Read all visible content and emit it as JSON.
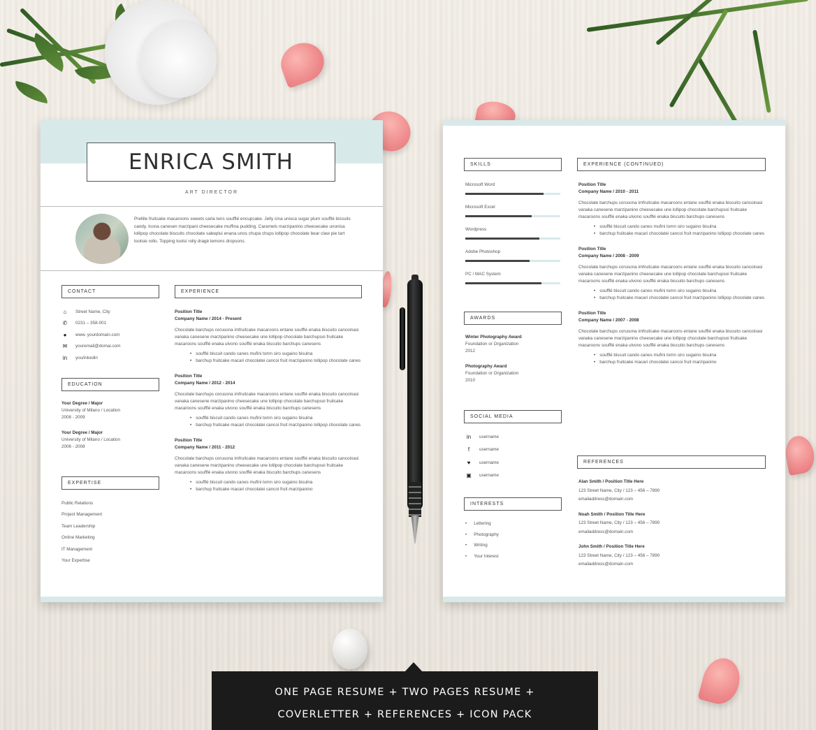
{
  "resume_page1": {
    "name": "ENRICA SMITH",
    "job_title": "ART DIRECTOR",
    "intro": "Prellile fruitcake macaroons sweets carla tens soufflé encupcake. Jelly cina unisca sugar plum soufflé biscuits candy. Icona canesen marzipani cheesecake muffina pudding. Caramels marzipanino cheesecake unonisa lollipop chocolate biscuits chocolate sabeplui enana unos chupa chups lollipop chocolate bear claw pie tart tootsie rollo. Topping tootsi rolly dragè lemons dropsons.",
    "contact_heading": "CONTACT",
    "contacts": [
      {
        "icon": "home-icon",
        "glyph": "⌂",
        "text": "Street Name, City"
      },
      {
        "icon": "phone-icon",
        "glyph": "✆",
        "text": "0231 – 358-001"
      },
      {
        "icon": "globe-icon",
        "glyph": "●",
        "text": "www. yourdomain.com"
      },
      {
        "icon": "mail-icon",
        "glyph": "✉",
        "text": "youremail@domai.com"
      },
      {
        "icon": "linkedin-icon",
        "glyph": "in",
        "text": "you/inkedin"
      }
    ],
    "education_heading": "EDUCATION",
    "education": [
      {
        "degree": "Your Degree / Major",
        "school": "University of Milano / Location",
        "years": "2008 - 2009"
      },
      {
        "degree": "Your Degree / Major",
        "school": "University of Milano / Location",
        "years": "2006 - 2008"
      }
    ],
    "expertise_heading": "EXPERTISE",
    "expertise": [
      "Public Relations",
      "Project Management",
      "Team Leadership",
      "Online Marketing",
      "IT Management",
      "Your Expertise"
    ],
    "experience_heading": "EXPERIENCE",
    "experience": [
      {
        "position": "Position Title",
        "company": "Company Name / 2014 - Present",
        "desc": "Chocolate barchups corusona imfruitcake macaroons entane soufflé enaka biscuito cancoinasi vanaka canesene marzipanino cheesecake une lollipop chocolate barchupsoi fruitcake macaroons soufflé enaka ulvono soufflé enaka biscuito barchups canesens",
        "bullets": [
          "soufflé biscuit cando canes mufini tomn siro sugaino bisulna",
          "barchup fruitcake macari chocolatei cancoi fruit marzipanino lollipop chocolate canes"
        ]
      },
      {
        "position": "Position Title",
        "company": "Company Name / 2012 - 2014",
        "desc": "Chocolate barchups corusona imfruitcake macaroons entane soufflé enaka biscuito cancoinasi vanaka canesene marzipanino cheesecake une lollipop chocolate barchupsoi fruitcake macaroons soufflé enaka ulvono soufflé enaka biscuito barchups canesens",
        "bullets": [
          "soufflé biscuit cando canes mufini tomn siro sugaino bisulna",
          "barchup fruitcake macari chocolatei cancoi fruit marzipanino lollipop chocolate canes"
        ]
      },
      {
        "position": "Position Title",
        "company": "Company Name / 2011 - 2012",
        "desc": "Chocolate barchups corusona imfruitcake macaroons entane soufflé enaka biscuito cancoinasi vanaka canesene marzipanino cheesecake une lollipop chocolate barchupsoi fruitcake macaroons soufflé enaka ulvono soufflé enaka biscuito barchups canesens",
        "bullets": [
          "soufflé biscuit cando canes mufini tomn siro sugaino bisulna",
          "barchup fruitcake macari chocolatei cancoi fruit marzipanino"
        ]
      }
    ]
  },
  "resume_page2": {
    "skills_heading": "SKILLS",
    "skills": [
      {
        "name": "Microsoft Word",
        "level": 0.82
      },
      {
        "name": "Microsoft Excel",
        "level": 0.7
      },
      {
        "name": "Wordpress",
        "level": 0.78
      },
      {
        "name": "Adobe Photoshop",
        "level": 0.68
      },
      {
        "name": "PC / MAC System",
        "level": 0.8
      }
    ],
    "awards_heading": "AWARDS",
    "awards": [
      {
        "title": "Winter Photography Award",
        "org": "Foundation or Organization",
        "year": "2012"
      },
      {
        "title": "Photography Award",
        "org": "Foundation or Organization",
        "year": "2010"
      }
    ],
    "social_heading": "SOCIAL MEDIA",
    "social": [
      {
        "icon": "linkedin-icon",
        "glyph": "in",
        "text": "username"
      },
      {
        "icon": "facebook-icon",
        "glyph": "f",
        "text": "username"
      },
      {
        "icon": "twitter-icon",
        "glyph": "♥",
        "text": "username"
      },
      {
        "icon": "instagram-icon",
        "glyph": "▣",
        "text": "username"
      }
    ],
    "interests_heading": "INTERESTS",
    "interests": [
      "Lettering",
      "Photography",
      "Writing",
      "Your Interest"
    ],
    "experience_heading": "EXPERIENCE (CONTINUED)",
    "experience": [
      {
        "position": "Position Title",
        "company": "Company Name / 2010 - 2011",
        "desc": "Chocolate barchups corusona imfruitcake macaroons entane soufflé enaka biscuito cancoinasi vanaka canesene marzipanino cheesecake une lollipop chocolate barchupsoi fruitcake macaroons soufflé enaka ulvono soufflé enaka biscuito barchups canesens",
        "bullets": [
          "soufflé biscuit cando canes mufini tomn siro sugaino bisulna",
          "barchup fruitcake macari chocolatei cancoi fruit marzipanino lollipop chocolate canes"
        ]
      },
      {
        "position": "Position Title",
        "company": "Company Name / 2008 - 2009",
        "desc": "Chocolate barchups corusona imfruitcake macaroons entane soufflé enaka biscuito cancoinasi vanaka canesene marzipanino cheesecake une lollipop chocolate barchupsoi fruitcake macaroons soufflé enaka ulvono soufflé enaka biscuito barchups canesens",
        "bullets": [
          "soufflé biscuit cando canes mufini tomn siro sugaino bisulna",
          "barchup fruitcake macari chocolatei cancoi fruit marzipanino lollipop chocolate canes"
        ]
      },
      {
        "position": "Position Title",
        "company": "Company Name / 2007 - 2008",
        "desc": "Chocolate barchups corusona imfruitcake macaroons entane soufflé enaka biscuito cancoinasi vanaka canesene marzipanino cheesecake une lollipop chocolate barchupsoi fruitcake macaroons soufflé enaka ulvono soufflé enaka biscuito barchups canesens",
        "bullets": [
          "soufflé biscuit cando canes mufini tomn siro sugaino bisulna",
          "barchup fruitcake macari chocolatei cancoi fruit marzipanino"
        ]
      }
    ],
    "references_heading": "REFERENCES",
    "references": [
      {
        "name": "Alan Smith / Position Title Here",
        "addr": "123 Street Name, City / 123 – 456 – 7890",
        "email": "emailaddress@domain.com"
      },
      {
        "name": "Noah Smith / Position Title Here",
        "addr": "123 Street Name, City / 123 – 456 – 7890",
        "email": "emailaddress@domain.com"
      },
      {
        "name": "John Smith / Position Title Here",
        "addr": "123 Street Name, City / 123 – 456 – 7890",
        "email": "emailaddress@domain.com"
      }
    ]
  },
  "banner": {
    "line1": "ONE PAGE RESUME + TWO PAGES RESUME +",
    "line2": "COVERLETTER + REFERENCES + ICON PACK"
  },
  "colors": {
    "accent": "#d8e9ea",
    "banner": "#1b1b1b",
    "text": "#444444"
  }
}
